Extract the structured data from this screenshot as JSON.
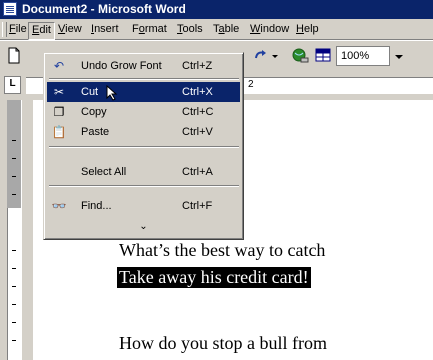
{
  "window": {
    "title": "Document2 - Microsoft Word"
  },
  "menubar": {
    "items": [
      {
        "label": "File",
        "underline": "F"
      },
      {
        "label": "Edit",
        "underline": "E"
      },
      {
        "label": "View",
        "underline": "V"
      },
      {
        "label": "Insert",
        "underline": "I"
      },
      {
        "label": "Format",
        "underline": "o"
      },
      {
        "label": "Tools",
        "underline": "T"
      },
      {
        "label": "Table",
        "underline": "a"
      },
      {
        "label": "Window",
        "underline": "W"
      },
      {
        "label": "Help",
        "underline": "H"
      }
    ]
  },
  "toolbar": {
    "zoom": "100%"
  },
  "ruler": {
    "mark_2": "2"
  },
  "edit_menu": {
    "items": [
      {
        "icon": "undo-icon",
        "glyph": "↶",
        "label": "Undo Grow Font",
        "shortcut": "Ctrl+Z"
      },
      {
        "icon": "scissors-icon",
        "glyph": "✂",
        "label": "Cut",
        "shortcut": "Ctrl+X",
        "highlighted": true
      },
      {
        "icon": "copy-icon",
        "glyph": "❐",
        "label": "Copy",
        "shortcut": "Ctrl+C"
      },
      {
        "icon": "paste-icon",
        "glyph": "📋",
        "label": "Paste",
        "shortcut": "Ctrl+V"
      },
      {
        "icon": "",
        "glyph": "",
        "label": "Select All",
        "shortcut": "Ctrl+A"
      },
      {
        "icon": "binoculars-icon",
        "glyph": "👓",
        "label": "Find...",
        "shortcut": "Ctrl+F"
      }
    ],
    "more_glyph": "⌄"
  },
  "document": {
    "lines": [
      "What’s the best way to catch",
      "Take away his credit card!",
      "How do you stop a bull from"
    ]
  }
}
